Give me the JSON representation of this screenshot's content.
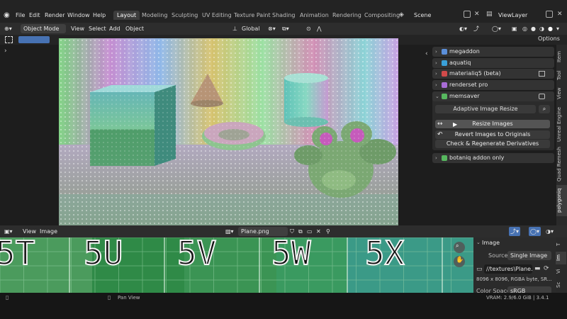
{
  "app": {
    "menu": [
      "File",
      "Edit",
      "Render",
      "Window",
      "Help"
    ],
    "workspaces": [
      "Layout",
      "Modeling",
      "Sculpting",
      "UV Editing",
      "Texture Paint",
      "Shading",
      "Animation",
      "Rendering",
      "Compositing"
    ],
    "active_workspace": "Layout",
    "scene": "Scene",
    "view_layer": "ViewLayer"
  },
  "viewport_header": {
    "mode": "Object Mode",
    "menus": [
      "View",
      "Select",
      "Add",
      "Object"
    ],
    "orientation": "Global",
    "options": "Options"
  },
  "sidebar": {
    "addons": [
      {
        "label": "megaddon",
        "color": "#5b8fd9"
      },
      {
        "label": "aquatiq",
        "color": "#3aa0d8"
      },
      {
        "label": "materialiq5 (beta)",
        "color": "#d04a4a"
      },
      {
        "label": "renderset pro",
        "color": "#a86cd6"
      },
      {
        "label": "memsaver",
        "color": "#57b85f"
      }
    ],
    "memsaver": {
      "adaptive": "Adaptive Image Resize",
      "resize": "Resize Images",
      "revert": "Revert Images to Originals",
      "check": "Check & Regenerate Derivatives"
    },
    "botaniq": {
      "label": "botaniq addon only",
      "color": "#57b85f"
    },
    "tabs": [
      "Item",
      "Tool",
      "View",
      "Unreal Engine",
      "Quad Remesh",
      "polygoniq"
    ]
  },
  "image_editor": {
    "menus": [
      "View",
      "Image"
    ],
    "image_name": "Plane.png",
    "grid_labels": [
      "5T",
      "5U",
      "5V",
      "5W",
      "5X"
    ],
    "props": {
      "section": "Image",
      "source_label": "Source",
      "source_value": "Single Image",
      "path": "//textures\\Plane....",
      "info": "8096 x 8096,  RGBA byte,  SR...",
      "colorspace_label": "Color Space",
      "colorspace_value": "sRGB"
    },
    "tabs": [
      "T",
      "Im",
      "Vi",
      "Sc"
    ]
  },
  "statusbar": {
    "pan": "Pan View",
    "vram": "VRAM: 2.9/6.0 GiB | 3.4.1"
  }
}
